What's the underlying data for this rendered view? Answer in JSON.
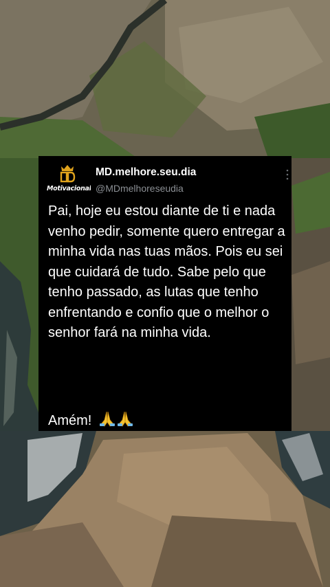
{
  "post": {
    "display_name": "MD.melhore.seu.dia",
    "handle": "@MDmelhoreseudia",
    "avatar_logo_text": "Motivacional",
    "avatar_logo_mark": "MD",
    "more_icon": "vertical-dots-icon",
    "body": "Pai, hoje eu estou diante de ti e nada venho pedir, somente quero entregar a minha vida nas tuas mãos. Pois eu sei que cuidará de tudo. Sabe pelo que tenho passado, as lutas que tenho enfrentando e confio que o melhor o senhor fará na minha vida.",
    "closing": "Amém!",
    "closing_emoji": "praying-hands-icon",
    "colors": {
      "card_background": "#000000",
      "name_text": "#ffffff",
      "handle_text": "#8b8f94",
      "logo_gold": "#e0a31c"
    }
  }
}
